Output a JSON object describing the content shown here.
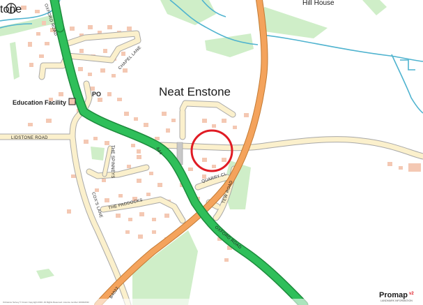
{
  "map": {
    "colors": {
      "background": "#ffffff",
      "buildings": "#f4c8b3",
      "green": "#cfeec8",
      "water": "#4fb3cf",
      "minor_road": "#fbf0cc",
      "road_casing": "#a8a8a8",
      "b_road": "#f4a35c",
      "a_road": "#2fbf5a",
      "a_road_casing": "#1d8a3c",
      "highlight_circle": "#e01b24"
    },
    "place_labels": {
      "village": "Neat Enstone",
      "top_left_partial": "tone",
      "top_right": "Hill House"
    },
    "poi_labels": {
      "post_office": "PO",
      "education": "Education Facility"
    },
    "road_labels": {
      "oxford_road_top": "OXFORD ROAD",
      "chapel_lane": "CHAPEL LANE",
      "lidstone_road": "LIDSTONE ROAD",
      "a44": "A44",
      "the_spinney": "THE SPINNEYS",
      "quarry_close": "QUARRY CL",
      "tew_road": "TEW ROAD",
      "coxs_lane": "COX'S LANE",
      "the_paddocks": "THE PADDOCKS",
      "oxford_road_bottom": "OXFORD ROAD",
      "b4022": "B4022"
    },
    "footer": {
      "copyright": "Ordnance Survey © Crown Copyright 2016. All Rights Reserved. Licence number 100022432",
      "brand": "Promap",
      "brand_version": "v2",
      "brand_sub": "LANDMARK INFORMATION"
    },
    "icons": {
      "scale_marker": "scale-circle-icon",
      "education_marker": "school-square-icon"
    }
  }
}
